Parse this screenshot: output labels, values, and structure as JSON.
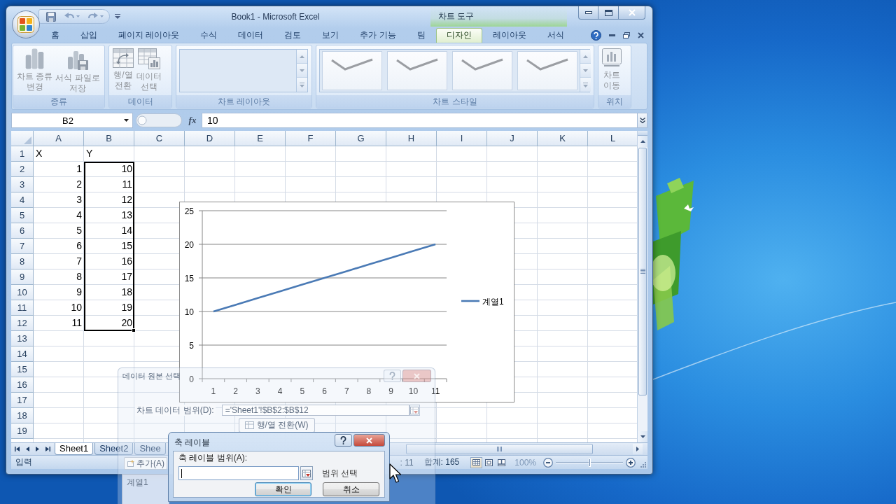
{
  "window": {
    "title": "Book1 - Microsoft Excel",
    "context_label": "차트 도구"
  },
  "ribbon": {
    "tabs": [
      {
        "label": "홈",
        "selected": false
      },
      {
        "label": "삽입",
        "selected": false
      },
      {
        "label": "페이지 레이아웃",
        "selected": false
      },
      {
        "label": "수식",
        "selected": false
      },
      {
        "label": "데이터",
        "selected": false
      },
      {
        "label": "검토",
        "selected": false
      },
      {
        "label": "보기",
        "selected": false
      },
      {
        "label": "추가 기능",
        "selected": false
      },
      {
        "label": "팀",
        "selected": false
      },
      {
        "label": "디자인",
        "selected": true
      },
      {
        "label": "레이아웃",
        "selected": false
      },
      {
        "label": "서식",
        "selected": false
      }
    ],
    "groups": [
      {
        "label": "종류",
        "kind": "buttons",
        "buttons": [
          {
            "label": "차트 종류\n변경",
            "disabled": true
          },
          {
            "label": "서식 파일로\n저장",
            "disabled": true
          }
        ]
      },
      {
        "label": "데이터",
        "kind": "buttons",
        "buttons": [
          {
            "label": "행/열\n전환",
            "disabled": true
          },
          {
            "label": "데이터\n선택",
            "disabled": true
          }
        ]
      },
      {
        "label": "차트 레이아웃",
        "kind": "gallery"
      },
      {
        "label": "차트 스타일",
        "kind": "gallery",
        "items": [
          {
            "selected": false
          },
          {
            "selected": false
          },
          {
            "selected": false
          },
          {
            "selected": false
          }
        ]
      },
      {
        "label": "위치",
        "kind": "buttons",
        "buttons": [
          {
            "label": "차트\n이동",
            "disabled": true
          }
        ]
      }
    ]
  },
  "formula_bar": {
    "name_box": "B2",
    "function_button": "fx",
    "formula": "10"
  },
  "sheet": {
    "columns": [
      "A",
      "B",
      "C",
      "D",
      "E",
      "F",
      "G",
      "H",
      "I",
      "J",
      "K",
      "L"
    ],
    "rows": [
      {
        "header": "1",
        "cells": [
          {
            "value": "X",
            "kind": "text",
            "selected": false
          },
          {
            "value": "Y",
            "kind": "text",
            "selected": false
          }
        ]
      },
      {
        "header": "2",
        "cells": [
          {
            "value": "1",
            "kind": "number",
            "selected": false
          },
          {
            "value": "10",
            "kind": "number",
            "selected": true
          }
        ]
      },
      {
        "header": "3",
        "cells": [
          {
            "value": "2",
            "kind": "number",
            "selected": false
          },
          {
            "value": "11",
            "kind": "number",
            "selected": true
          }
        ]
      },
      {
        "header": "4",
        "cells": [
          {
            "value": "3",
            "kind": "number",
            "selected": false
          },
          {
            "value": "12",
            "kind": "number",
            "selected": true
          }
        ]
      },
      {
        "header": "5",
        "cells": [
          {
            "value": "4",
            "kind": "number",
            "selected": false
          },
          {
            "value": "13",
            "kind": "number",
            "selected": true
          }
        ]
      },
      {
        "header": "6",
        "cells": [
          {
            "value": "5",
            "kind": "number",
            "selected": false
          },
          {
            "value": "14",
            "kind": "number",
            "selected": true
          }
        ]
      },
      {
        "header": "7",
        "cells": [
          {
            "value": "6",
            "kind": "number",
            "selected": false
          },
          {
            "value": "15",
            "kind": "number",
            "selected": true
          }
        ]
      },
      {
        "header": "8",
        "cells": [
          {
            "value": "7",
            "kind": "number",
            "selected": false
          },
          {
            "value": "16",
            "kind": "number",
            "selected": true
          }
        ]
      },
      {
        "header": "9",
        "cells": [
          {
            "value": "8",
            "kind": "number",
            "selected": false
          },
          {
            "value": "17",
            "kind": "number",
            "selected": true
          }
        ]
      },
      {
        "header": "10",
        "cells": [
          {
            "value": "9",
            "kind": "number",
            "selected": false
          },
          {
            "value": "18",
            "kind": "number",
            "selected": true
          }
        ]
      },
      {
        "header": "11",
        "cells": [
          {
            "value": "10",
            "kind": "number",
            "selected": false
          },
          {
            "value": "19",
            "kind": "number",
            "selected": true
          }
        ]
      },
      {
        "header": "12",
        "cells": [
          {
            "value": "11",
            "kind": "number",
            "selected": false
          },
          {
            "value": "20",
            "kind": "number",
            "selected": true
          }
        ]
      },
      {
        "header": "13"
      },
      {
        "header": "14"
      },
      {
        "header": "15"
      },
      {
        "header": "16"
      },
      {
        "header": "17"
      },
      {
        "header": "18"
      },
      {
        "header": "19"
      }
    ]
  },
  "chart": {
    "chart_data": {
      "type": "line",
      "categories": [
        "1",
        "2",
        "3",
        "4",
        "5",
        "6",
        "7",
        "8",
        "9",
        "10",
        "11"
      ],
      "series": [
        {
          "name": "계열1",
          "color": "#4a7ab5",
          "values": [
            10,
            11,
            12,
            13,
            14,
            15,
            16,
            17,
            18,
            19,
            20
          ]
        }
      ],
      "ylim": [
        0,
        25
      ],
      "yticks": [
        0,
        5,
        10,
        15,
        20,
        25
      ],
      "grid": true
    }
  },
  "sheet_tabs": [
    {
      "label": "Sheet1",
      "selected": true
    },
    {
      "label": "Sheet2",
      "selected": false
    },
    {
      "label": "Shee",
      "selected": false
    }
  ],
  "status_bar": {
    "mode": "입력",
    "count": ": 11",
    "sum": "합계: 165",
    "views": [
      {
        "selected": true
      },
      {
        "selected": false
      },
      {
        "selected": false
      }
    ],
    "zoom": "100%",
    "zoom_slider": {
      "level": 0.5
    }
  },
  "dialogs": [
    {
      "kind": "select_source",
      "title": "데이터 원본 선택",
      "range_label": "차트 데이터 범위(D):",
      "range_value": "='Sheet1'!$B$2:$B$12",
      "switch_button": "행/열 전환(W)",
      "add_button": "추가(A)",
      "series": [
        {
          "label": "계열1",
          "selected": false
        }
      ]
    },
    {
      "kind": "axis_labels",
      "title": "축 레이블",
      "range_label": "축 레이블 범위(A):",
      "range_hint": "범위 선택",
      "buttons": [
        {
          "label": "확인",
          "default": true
        },
        {
          "label": "취소",
          "default": false
        }
      ]
    }
  ]
}
